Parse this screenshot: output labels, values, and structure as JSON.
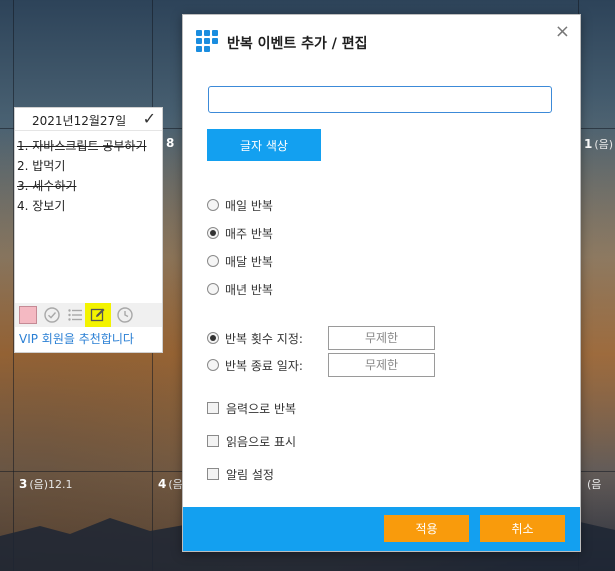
{
  "calendar": {
    "cells": [
      {
        "num": "8",
        "sub": ""
      },
      {
        "num": "1",
        "sub": "(음)"
      },
      {
        "num": "3",
        "sub": "(음)12.1"
      },
      {
        "num": "4",
        "sub": "(음"
      },
      {
        "num": "",
        "sub": "(음"
      }
    ]
  },
  "memo": {
    "date": "2021년12월27일",
    "check_icon": "checkmark-icon",
    "items": [
      {
        "text": "1. 자바스크립트 공부하기",
        "done": true
      },
      {
        "text": "2. 밥먹기",
        "done": false
      },
      {
        "text": "3. 세수하기",
        "done": true
      },
      {
        "text": "4. 장보기",
        "done": false
      }
    ],
    "swatch_color": "#f4b9c2",
    "footer_link": "VIP 회원을 추천합니다"
  },
  "dialog": {
    "title": "반복 이벤트 추가 / 편집",
    "close_symbol": "×",
    "input_value": "",
    "color_button": "글자 색상",
    "repeat_options": [
      {
        "label": "매일 반복",
        "selected": false
      },
      {
        "label": "매주 반복",
        "selected": true
      },
      {
        "label": "매달 반복",
        "selected": false
      },
      {
        "label": "매년 반복",
        "selected": false
      }
    ],
    "count_label": "반복 횟수 지정:",
    "count_value": "무제한",
    "end_label": "반복 종료 일자:",
    "end_value": "무제한",
    "checkboxes": [
      {
        "label": "음력으로 반복",
        "checked": false
      },
      {
        "label": "읽음으로 표시",
        "checked": false
      },
      {
        "label": "알림 설정",
        "checked": false
      }
    ],
    "apply_button": "적용",
    "cancel_button": "취소"
  },
  "colors": {
    "accent_blue": "#13a0f0",
    "button_orange": "#f99b0c",
    "highlight_yellow": "#f3f300"
  }
}
